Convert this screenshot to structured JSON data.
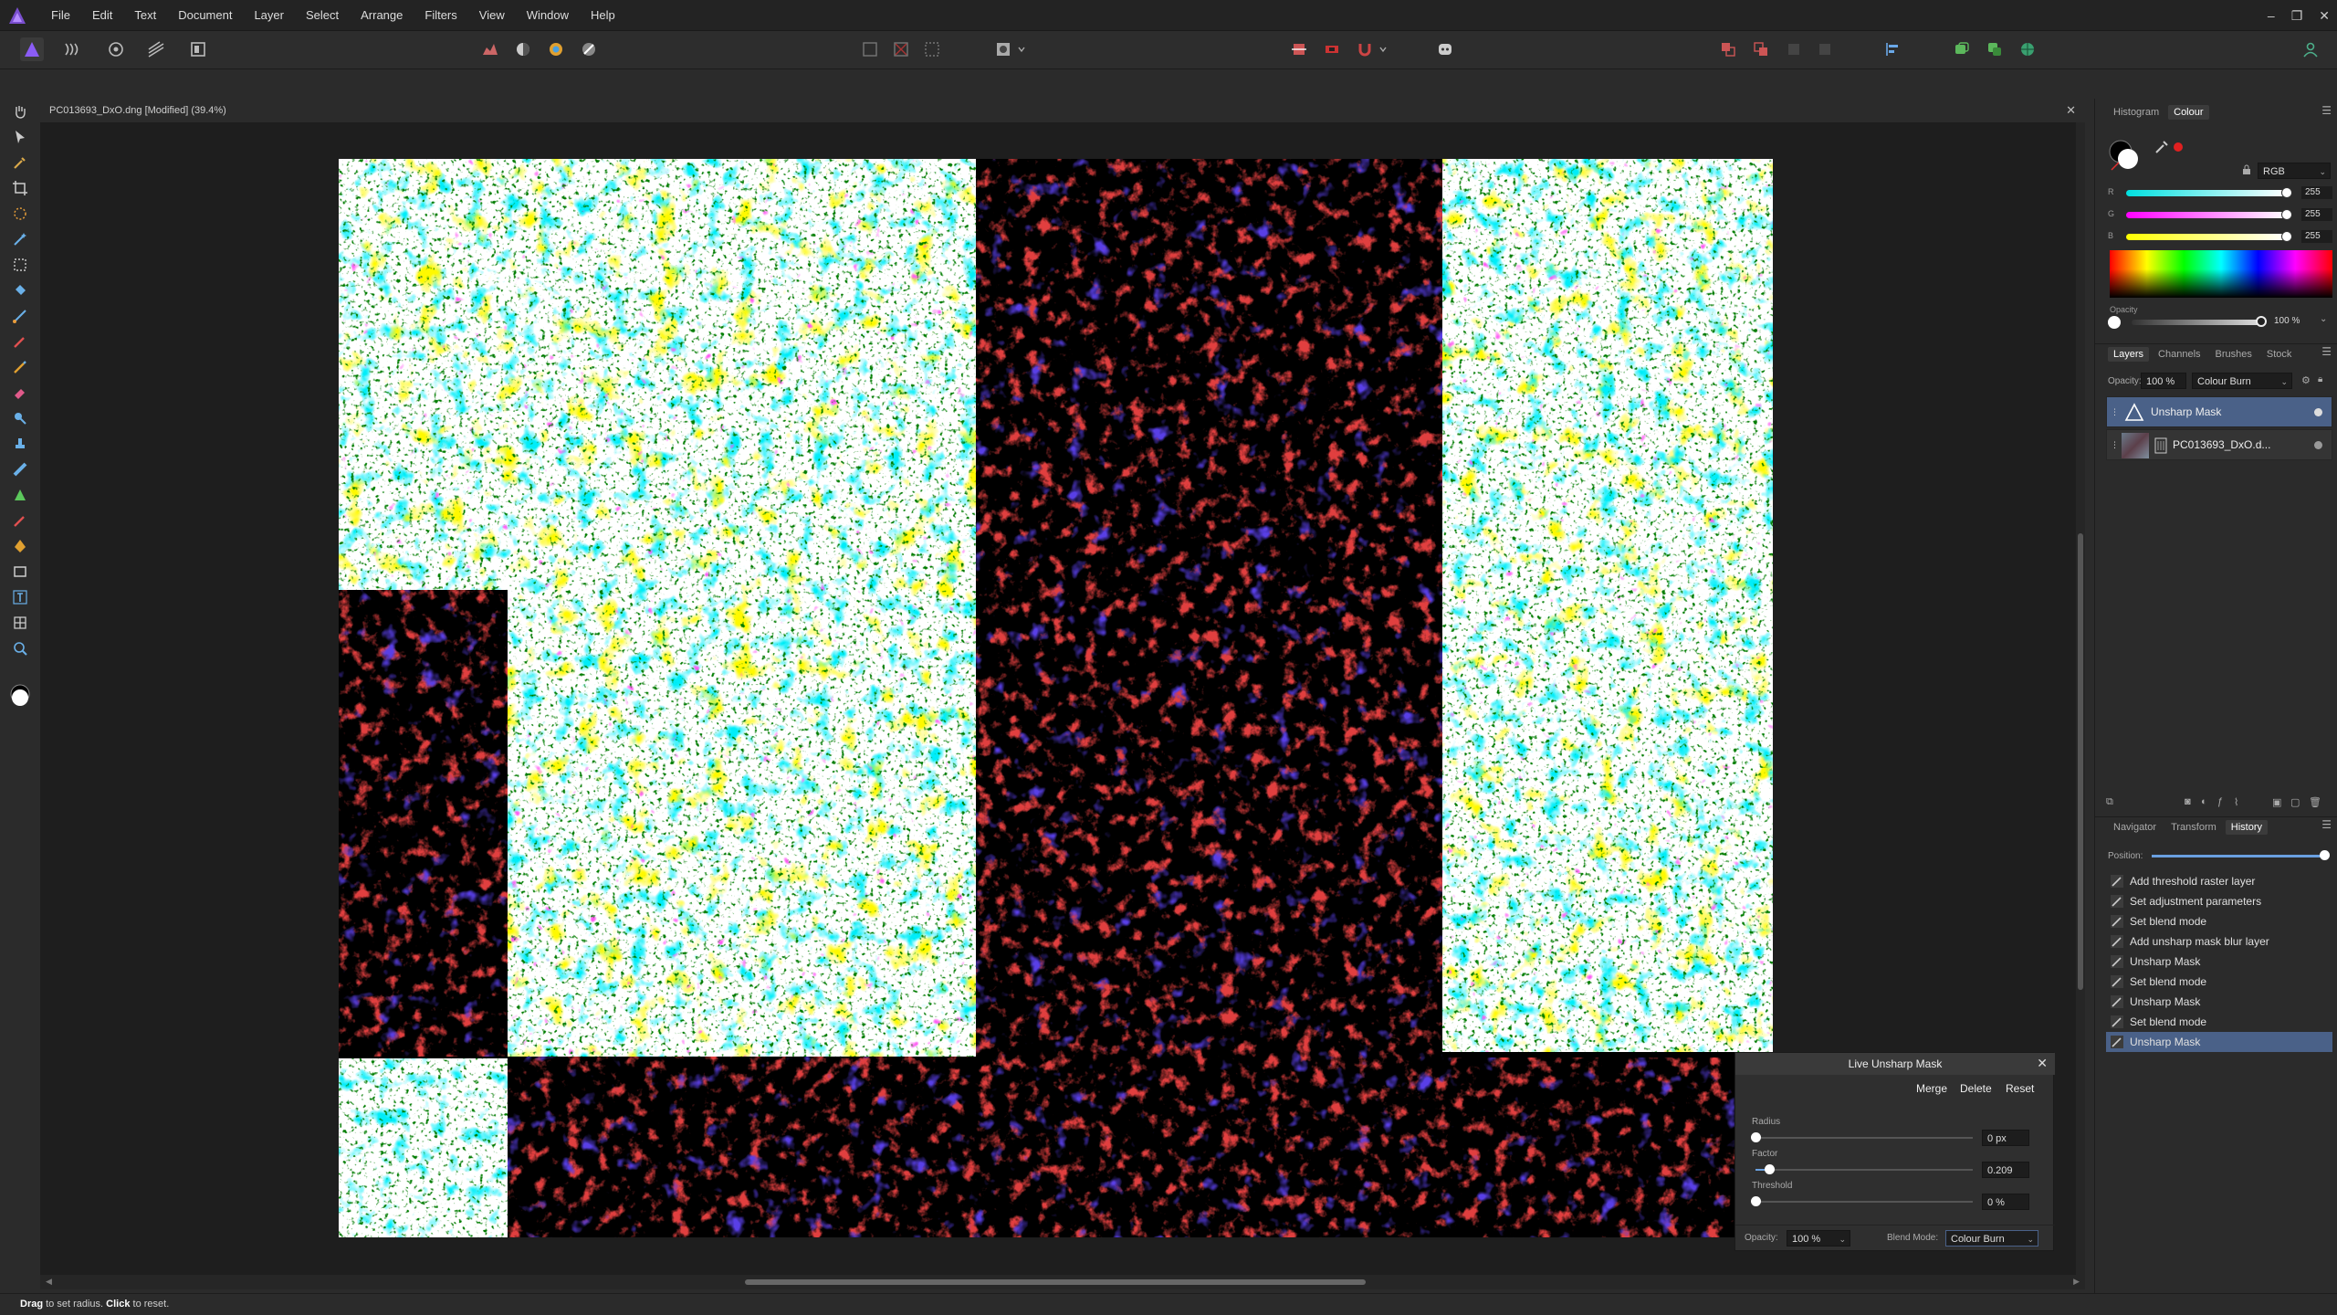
{
  "menu": {
    "items": [
      "File",
      "Edit",
      "Text",
      "Document",
      "Layer",
      "Select",
      "Arrange",
      "Filters",
      "View",
      "Window",
      "Help"
    ],
    "window_controls": [
      "–",
      "❐",
      "✕"
    ]
  },
  "document": {
    "tab_title": "PC013693_DxO.dng [Modified] (39.4%)",
    "close": "✕"
  },
  "status": {
    "drag": "Drag",
    "drag_desc": " to set radius. ",
    "click": "Click",
    "click_desc": " to reset."
  },
  "colour_panel": {
    "tabs": [
      "Histogram",
      "Colour"
    ],
    "active_tab": "Colour",
    "model": "RGB",
    "channels": [
      {
        "label": "R",
        "value": "255"
      },
      {
        "label": "G",
        "value": "255"
      },
      {
        "label": "B",
        "value": "255"
      }
    ],
    "opacity_label": "Opacity",
    "opacity_value": "100 %"
  },
  "layers_panel": {
    "tabs": [
      "Layers",
      "Channels",
      "Brushes",
      "Stock"
    ],
    "active_tab": "Layers",
    "opacity_label": "Opacity:",
    "opacity_value": "100 %",
    "blend_mode": "Colour Burn",
    "layers": [
      {
        "name": "Unsharp Mask",
        "selected": true
      },
      {
        "name": "PC013693_DxO.d...",
        "selected": false
      }
    ]
  },
  "history_panel": {
    "tabs": [
      "Navigator",
      "Transform",
      "History"
    ],
    "active_tab": "History",
    "position_label": "Position:",
    "items": [
      "Add threshold raster layer",
      "Set adjustment parameters",
      "Set blend mode",
      "Add unsharp mask blur layer",
      "Unsharp Mask",
      "Set blend mode",
      "Unsharp Mask",
      "Set blend mode",
      "Unsharp Mask"
    ],
    "selected_index": 8
  },
  "usm_dialog": {
    "title": "Live Unsharp Mask",
    "close": "✕",
    "buttons": [
      "Merge",
      "Delete",
      "Reset"
    ],
    "radius_label": "Radius",
    "radius_value": "0 px",
    "factor_label": "Factor",
    "factor_value": "0.209",
    "threshold_label": "Threshold",
    "threshold_value": "0 %",
    "opacity_label": "Opacity:",
    "opacity_value": "100 %",
    "blend_label": "Blend Mode:",
    "blend_value": "Colour Burn"
  },
  "colors": {
    "accent": "#4a6188",
    "brand": "#7a4fcf"
  }
}
